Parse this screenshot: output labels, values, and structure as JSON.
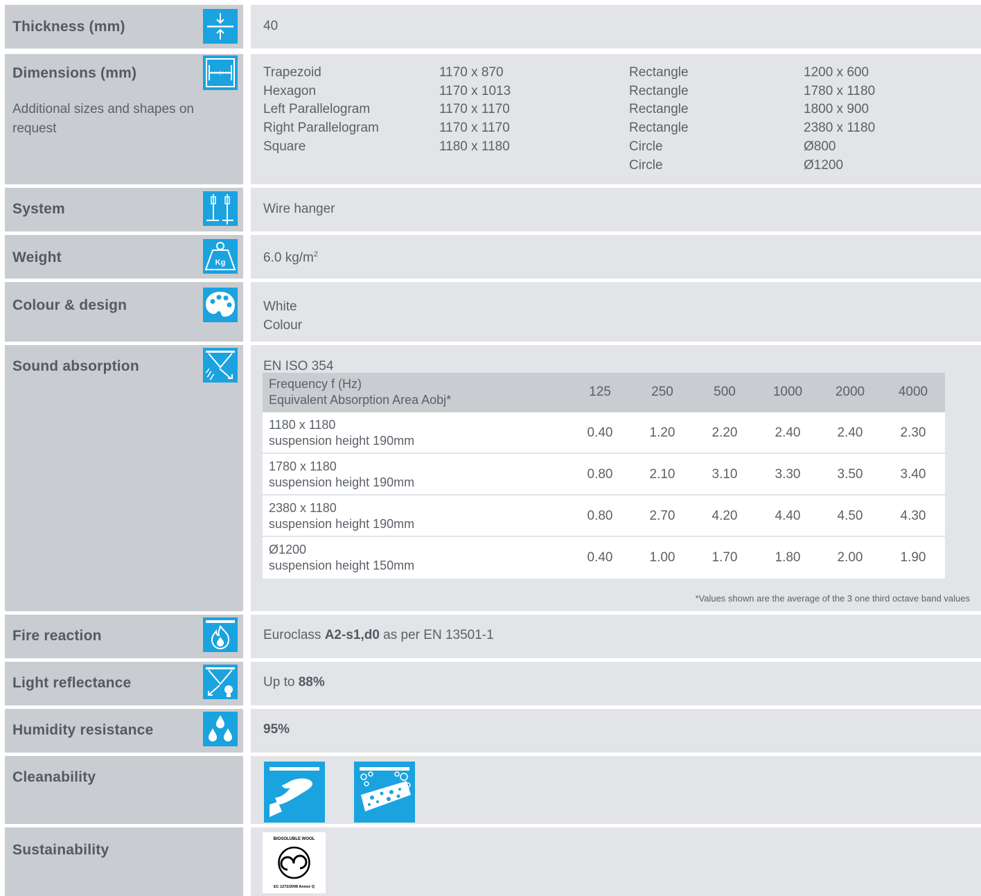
{
  "colors": {
    "accent": "#1aa3df",
    "label_bg": "#c9ccd0",
    "value_bg": "#e2e4e7"
  },
  "thickness": {
    "label": "Thickness (mm)",
    "icon": "thickness-icon",
    "value": "40"
  },
  "dimensions": {
    "label": "Dimensions (mm)",
    "sub": "Additional sizes and shapes on request",
    "icon": "dimension-ruler-icon",
    "left_shapes": [
      "Trapezoid",
      "Hexagon",
      "Left Parallelogram",
      "Right Parallelogram",
      "Square"
    ],
    "left_sizes": [
      "1170 x 870",
      "1170 x 1013",
      "1170 x 1170",
      "1170 x 1170",
      "1180 x 1180"
    ],
    "right_shapes": [
      "Rectangle",
      "Rectangle",
      "Rectangle",
      "Rectangle",
      "Circle",
      "Circle"
    ],
    "right_sizes": [
      "1200 x 600",
      "1780 x 1180",
      "1800 x 900",
      "2380 x 1180",
      "Ø800",
      "Ø1200"
    ]
  },
  "system": {
    "label": "System",
    "icon": "wire-hanger-icon",
    "value": "Wire hanger"
  },
  "weight": {
    "label": "Weight",
    "icon": "weight-kg-icon",
    "value": "6.0 kg/m",
    "sup": "2"
  },
  "colour": {
    "label": "Colour & design",
    "icon": "palette-icon",
    "values": [
      "White",
      "Colour"
    ]
  },
  "sound": {
    "label": "Sound absorption",
    "icon": "sound-absorption-icon",
    "standard": "EN ISO 354",
    "header_line1": "Frequency f (Hz)",
    "header_line2": "Equivalent Absorption Area Aobj*",
    "frequencies": [
      "125",
      "250",
      "500",
      "1000",
      "2000",
      "4000"
    ],
    "rows": [
      {
        "size": "1180 x 1180",
        "desc": "suspension height 190mm",
        "values": [
          "0.40",
          "1.20",
          "2.20",
          "2.40",
          "2.40",
          "2.30"
        ]
      },
      {
        "size": "1780 x 1180",
        "desc": "suspension height 190mm",
        "values": [
          "0.80",
          "2.10",
          "3.10",
          "3.30",
          "3.50",
          "3.40"
        ]
      },
      {
        "size": "2380 x 1180",
        "desc": "suspension height 190mm",
        "values": [
          "0.80",
          "2.70",
          "4.20",
          "4.40",
          "4.50",
          "4.30"
        ]
      },
      {
        "size": "Ø1200",
        "desc": "suspension height 150mm",
        "values": [
          "0.40",
          "1.00",
          "1.70",
          "1.80",
          "2.00",
          "1.90"
        ]
      }
    ],
    "note": "*Values shown are the average of the 3 one third octave band values"
  },
  "fire": {
    "label": "Fire reaction",
    "icon": "fire-reaction-icon",
    "prefix": "Euroclass ",
    "bold": "A2-s1,d0",
    "suffix": " as per EN 13501-1"
  },
  "light": {
    "label": "Light reflectance",
    "icon": "light-reflectance-icon",
    "prefix": "Up to ",
    "bold": "88%"
  },
  "humidity": {
    "label": "Humidity resistance",
    "icon": "humidity-drops-icon",
    "bold": "95%"
  },
  "cleanability": {
    "label": "Cleanability",
    "icons": [
      "wipe-cloth-icon",
      "wash-sponge-icon"
    ]
  },
  "sustainability": {
    "label": "Sustainability",
    "seal_top": "BIOSOLUBLE WOOL",
    "seal_bottom": "EC 1272/2008 Annex Q",
    "icon": "biosoluble-wool-seal-icon"
  }
}
